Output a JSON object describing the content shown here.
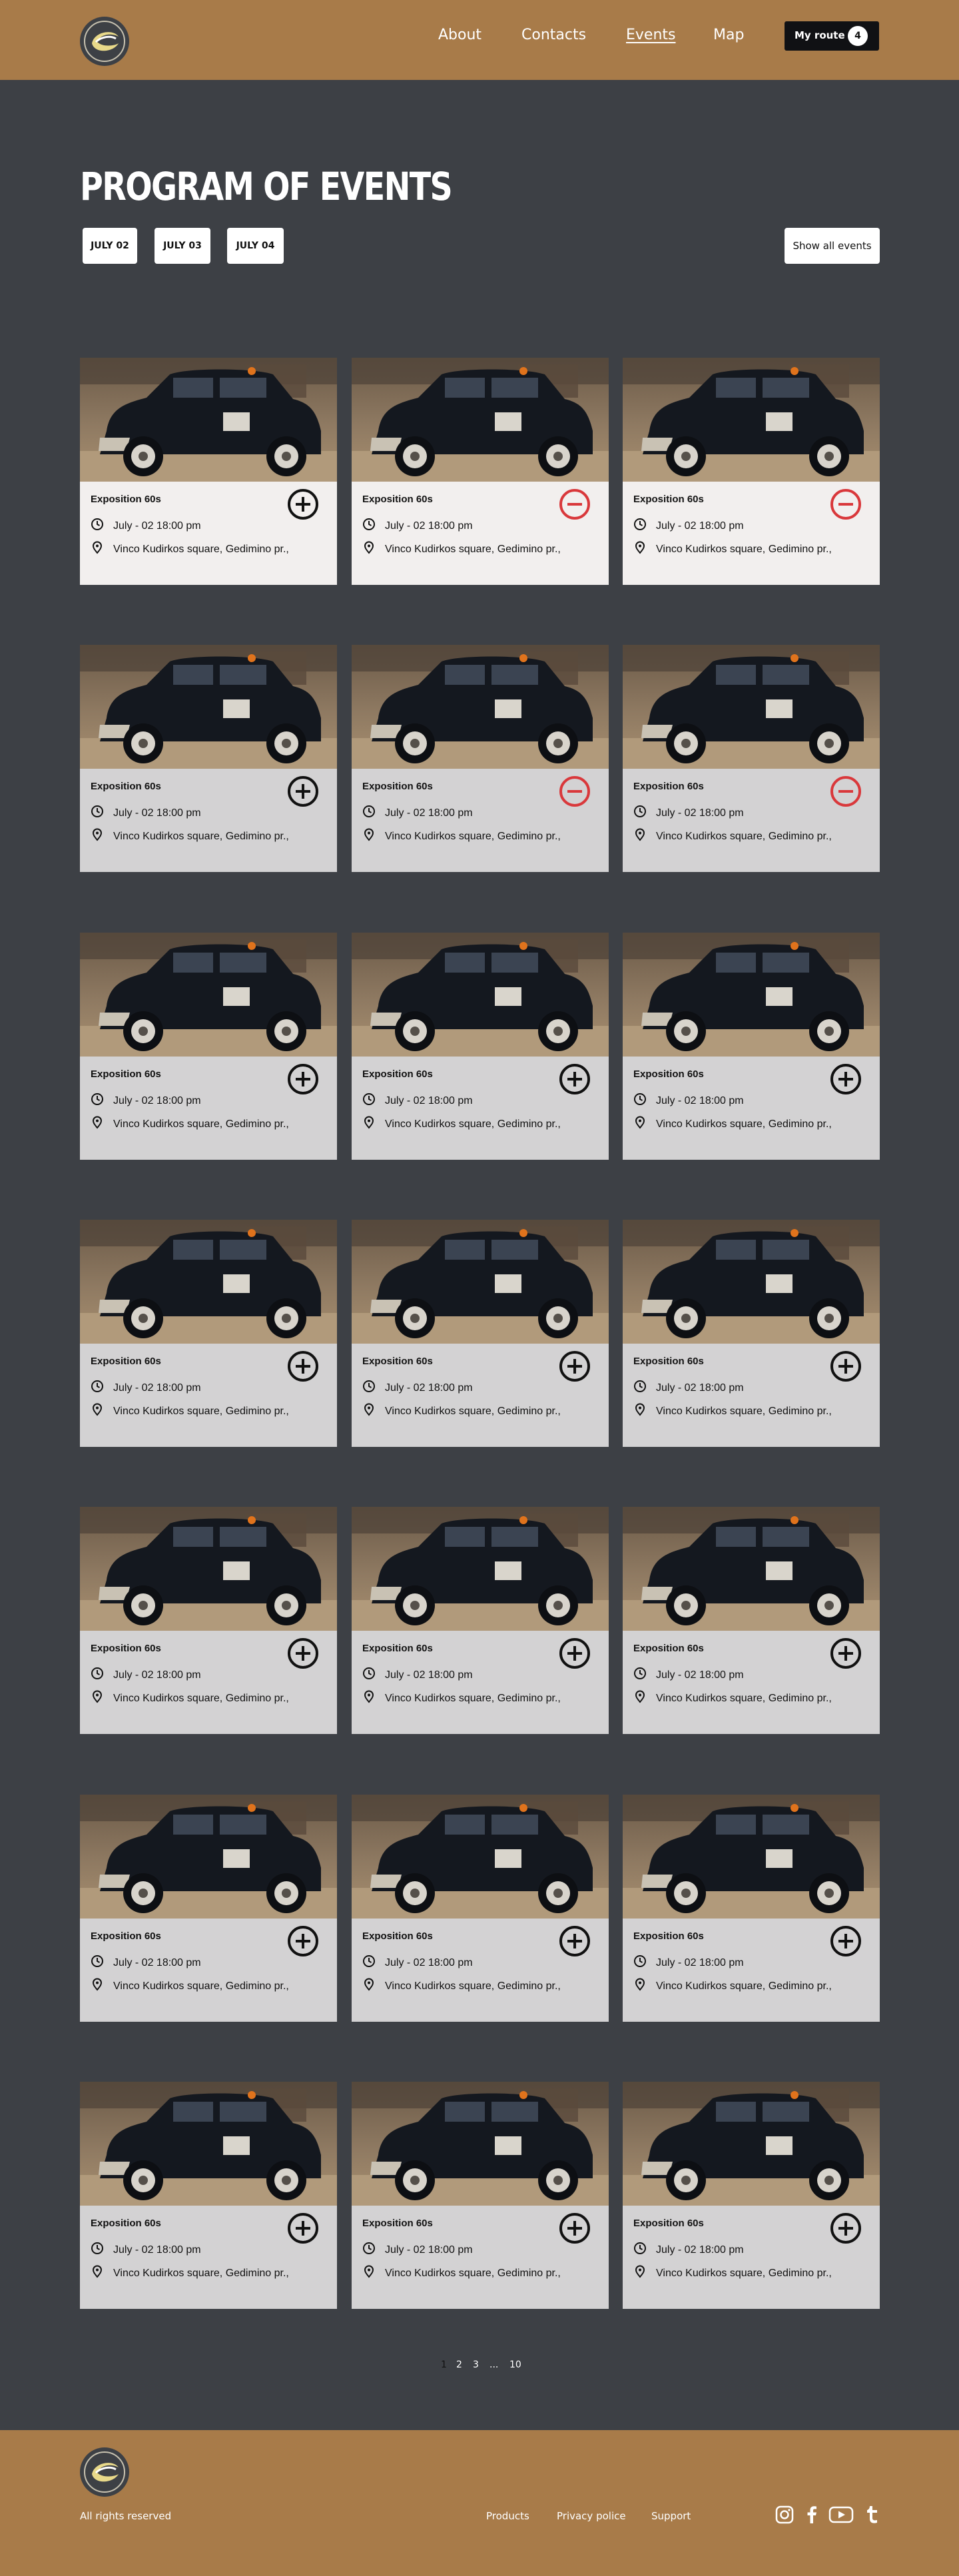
{
  "header": {
    "nav": [
      "About",
      "Contacts",
      "Events",
      "Map"
    ],
    "active_nav": "Events",
    "route_label": "My route",
    "route_count": "4"
  },
  "page": {
    "title": "PROGRAM OF EVENTS",
    "dates": [
      "JULY 02",
      "JULY 03",
      "JULY 04"
    ],
    "show_all": "Show all events"
  },
  "event": {
    "image": "vintage-black-car-photo",
    "title": "Exposition 60s",
    "time": "July - 02 18:00 pm",
    "place": "Vinco Kudirkos square, Gedimino pr.,"
  },
  "cards": [
    {
      "state": "add",
      "highlight": true
    },
    {
      "state": "remove",
      "highlight": true
    },
    {
      "state": "remove",
      "highlight": true
    },
    {
      "state": "add",
      "highlight": false
    },
    {
      "state": "remove",
      "highlight": false
    },
    {
      "state": "remove",
      "highlight": false
    },
    {
      "state": "add",
      "highlight": false
    },
    {
      "state": "add",
      "highlight": false
    },
    {
      "state": "add",
      "highlight": false
    },
    {
      "state": "add",
      "highlight": false
    },
    {
      "state": "add",
      "highlight": false
    },
    {
      "state": "add",
      "highlight": false
    },
    {
      "state": "add",
      "highlight": false
    },
    {
      "state": "add",
      "highlight": false
    },
    {
      "state": "add",
      "highlight": false
    },
    {
      "state": "add",
      "highlight": false
    },
    {
      "state": "add",
      "highlight": false
    },
    {
      "state": "add",
      "highlight": false
    },
    {
      "state": "add",
      "highlight": false
    },
    {
      "state": "add",
      "highlight": false
    },
    {
      "state": "add",
      "highlight": false
    }
  ],
  "pagination": {
    "pages": [
      "1",
      "2",
      "3",
      "...",
      "10"
    ],
    "current": "1"
  },
  "footer": {
    "rights": "All rights reserved",
    "links": [
      "Products",
      "Privacy police",
      "Support"
    ],
    "social": [
      "instagram-icon",
      "facebook-icon",
      "youtube-icon",
      "tumblr-icon"
    ]
  },
  "colors": {
    "brand": "#a87b49",
    "background": "#3d4045",
    "remove": "#d9383b"
  }
}
